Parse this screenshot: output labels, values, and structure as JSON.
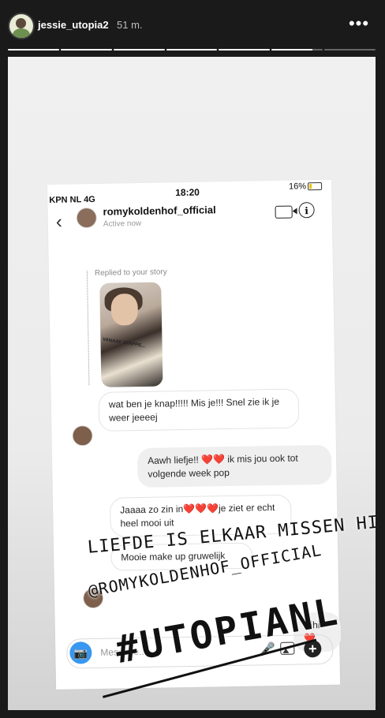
{
  "story_header": {
    "username": "jessie_utopia2",
    "time_ago": "51 m.",
    "more_glyph": "•••",
    "progress_segments": 7,
    "current_segment": 6
  },
  "screenshot": {
    "status": {
      "carrier": "KPN NL  4G",
      "time": "18:20",
      "battery": "16%"
    },
    "chat": {
      "back_glyph": "‹",
      "name": "romykoldenhof_official",
      "status": "Active now",
      "info_glyph": "i"
    },
    "replied_label": "Replied to your story",
    "thumb_text": "VANAAF STAPPE...",
    "messages": [
      {
        "from": "them",
        "text": "wat ben je knap!!!!! Mis je!!! Snel zie ik je weer jeeeej"
      },
      {
        "from": "me",
        "text": "Aawh liefje!! ❤️❤️ ik mis jou ook tot volgende week pop"
      },
      {
        "from": "them",
        "text": "Jaaaa zo zin in❤️❤️❤️je ziet er echt heel mooi uit"
      },
      {
        "from": "them",
        "text": "Mooie make up gruwelijk"
      },
      {
        "from": "me",
        "text": "Hihi❤️"
      }
    ],
    "composer": {
      "placeholder": "Message...",
      "camera_glyph": "📷",
      "mic_glyph": "🎤",
      "plus_glyph": "+"
    }
  },
  "overlay_text": {
    "line1": "LIEFDE IS ELKAAR MISSEN HIHI❤️❤️",
    "line2": "@ROMYKOLDENHOF_OFFICIAL",
    "line3": "#UTOPIANL"
  }
}
